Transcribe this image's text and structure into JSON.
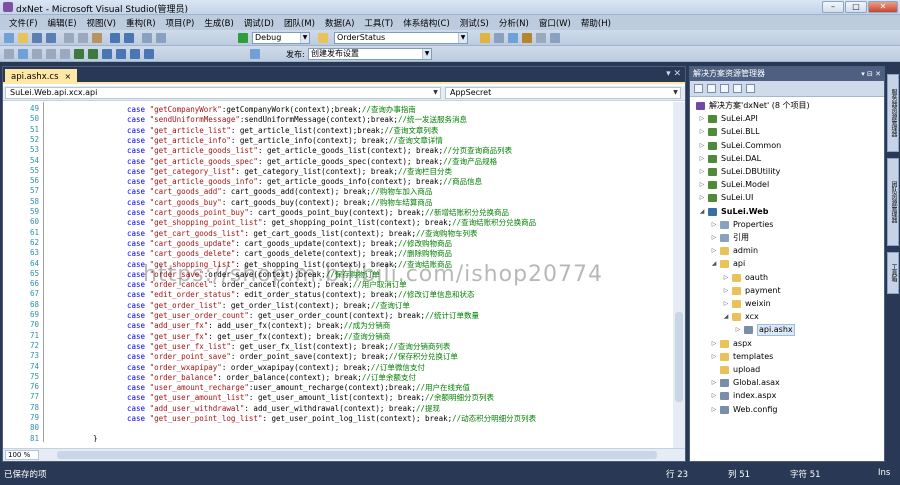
{
  "window": {
    "title": "dxNet - Microsoft Visual Studio(管理员)",
    "minimize": "–",
    "maximize": "□",
    "close": "✕"
  },
  "menu": [
    "文件(F)",
    "编辑(E)",
    "视图(V)",
    "重构(R)",
    "项目(P)",
    "生成(B)",
    "调试(D)",
    "团队(M)",
    "数据(A)",
    "工具(T)",
    "体系结构(C)",
    "测试(S)",
    "分析(N)",
    "窗口(W)",
    "帮助(H)"
  ],
  "toolbar": {
    "config": "Debug",
    "find_combo": "OrderStatus",
    "publish_label": "发布:",
    "publish_combo": "创建发布设置"
  },
  "editor": {
    "tab_label": "api.ashx.cs",
    "tab_close": "×",
    "nav_left": "SuLei.Web.api.xcx.api",
    "nav_right": "AppSecret",
    "zoom": "100 %",
    "watermark": "https://shop.m.bilibili.com/ishop20774"
  },
  "code_lines": [
    {
      "n": "49",
      "c": "case",
      "s": "\"getCompanyWork\"",
      "b": ":getCompanyWork(context);break;",
      "m": "//查询办事指南"
    },
    {
      "n": "50",
      "c": "case",
      "s": "\"sendUniformMessage\"",
      "b": ":sendUniformMessage(context);break;",
      "m": "//统一发送服务消息"
    },
    {
      "n": "51",
      "c": "case",
      "s": "\"get_article_list\"",
      "b": ": get_article_list(context);break;",
      "m": "//查询文章列表"
    },
    {
      "n": "52",
      "c": "case",
      "s": "\"get_article_info\"",
      "b": ": get_article_info(context); break;",
      "m": "//查询文章详情"
    },
    {
      "n": "53",
      "c": "case",
      "s": "\"get_article_goods_list\"",
      "b": ": get_article_goods_list(context); break;",
      "m": "//分页查询商品列表"
    },
    {
      "n": "54",
      "c": "case",
      "s": "\"get_article_goods_spec\"",
      "b": ": get_article_goods_spec(context); break;",
      "m": "//查询产品规格"
    },
    {
      "n": "55",
      "c": "case",
      "s": "\"get_category_list\"",
      "b": ": get_category_list(context); break;",
      "m": "//查询栏目分类"
    },
    {
      "n": "56",
      "c": "case",
      "s": "\"get_article_goods_info\"",
      "b": ": get_article_goods_info(context); break;",
      "m": "//商品信息"
    },
    {
      "n": "57",
      "c": "case",
      "s": "\"cart_goods_add\"",
      "b": ": cart_goods_add(context); break;",
      "m": "//购物车加入商品"
    },
    {
      "n": "58",
      "c": "case",
      "s": "\"cart_goods_buy\"",
      "b": ": cart_goods_buy(context); break;",
      "m": "//购物车结算商品"
    },
    {
      "n": "59",
      "c": "case",
      "s": "\"cart_goods_point_buy\"",
      "b": ": cart_goods_point_buy(context); break;",
      "m": "//新增结账积分兑换商品"
    },
    {
      "n": "60",
      "c": "case",
      "s": "\"get_shopping_point_list\"",
      "b": ": get_shopping_point_list(context); break;",
      "m": "//查询结账积分兑换商品"
    },
    {
      "n": "61",
      "c": "case",
      "s": "\"get_cart_goods_list\"",
      "b": ": get_cart_goods_list(context); break;",
      "m": "//查询购物车列表"
    },
    {
      "n": "62",
      "c": "case",
      "s": "\"cart_goods_update\"",
      "b": ": cart_goods_update(context); break;",
      "m": "//修改购物商品"
    },
    {
      "n": "63",
      "c": "case",
      "s": "\"cart_goods_delete\"",
      "b": ": cart_goods_delete(context); break;",
      "m": "//删除购物商品"
    },
    {
      "n": "64",
      "c": "case",
      "s": "\"get_shopping_list\"",
      "b": ": get_shopping_list(context); break;",
      "m": "//查询结账商品"
    },
    {
      "n": "65",
      "c": "case",
      "s": "\"order_save\"",
      "b": ":order_save(context);break;",
      "m": "//保存购物订单"
    },
    {
      "n": "66",
      "c": "case",
      "s": "\"order_cancel\"",
      "b": ": order_cancel(context); break;",
      "m": "//用户取消订单"
    },
    {
      "n": "67",
      "c": "case",
      "s": "\"edit_order_status\"",
      "b": ": edit_order_status(context); break;",
      "m": "//修改订单信息和状态"
    },
    {
      "n": "68",
      "c": "case",
      "s": "\"get_order_list\"",
      "b": ": get_order_list(context); break;",
      "m": "//查询订单"
    },
    {
      "n": "69",
      "c": "case",
      "s": "\"get_user_order_count\"",
      "b": ": get_user_order_count(context); break;",
      "m": "//统计订单数量"
    },
    {
      "n": "70",
      "c": "case",
      "s": "\"add_user_fx\"",
      "b": ": add_user_fx(context); break;",
      "m": "//成为分销商"
    },
    {
      "n": "71",
      "c": "case",
      "s": "\"get_user_fx\"",
      "b": ": get_user_fx(context); break;",
      "m": "//查询分销商"
    },
    {
      "n": "72",
      "c": "case",
      "s": "\"get_user_fx_list\"",
      "b": ": get_user_fx_list(context); break;",
      "m": "//查询分销商列表"
    },
    {
      "n": "73",
      "c": "case",
      "s": "\"order_point_save\"",
      "b": ": order_point_save(context); break;",
      "m": "//保存积分兑换订单"
    },
    {
      "n": "74",
      "c": "case",
      "s": "\"order_wxapipay\"",
      "b": ": order_wxapipay(context); break;",
      "m": "//订单微信支付"
    },
    {
      "n": "75",
      "c": "case",
      "s": "\"order_balance\"",
      "b": ": order_balance(context); break;",
      "m": "//订单余额支付"
    },
    {
      "n": "76",
      "c": "case",
      "s": "\"user_amount_recharge\"",
      "b": ":user_amount_recharge(context);break;",
      "m": "//用户在线充值"
    },
    {
      "n": "77",
      "c": "case",
      "s": "\"get_user_amount_list\"",
      "b": ": get_user_amount_list(context); break;",
      "m": "//余额明细分页列表"
    },
    {
      "n": "78",
      "c": "case",
      "s": "\"add_user_withdrawal\"",
      "b": ": add_user_withdrawal(context); break;",
      "m": "//提现"
    },
    {
      "n": "79",
      "c": "case",
      "s": "\"get_user_point_log_list\"",
      "b": ": get_user_point_log_list(context); break;",
      "m": "//动态积分明细分页列表"
    },
    {
      "n": "80",
      "c": "",
      "s": "",
      "b": "",
      "m": ""
    },
    {
      "n": "81",
      "c": "",
      "s": "",
      "b": "}",
      "m": ""
    }
  ],
  "solution": {
    "title": "解决方案资源管理器",
    "title_buttons": "▾ ⊟ ✕",
    "nodes": [
      {
        "label": "解决方案'dxNet' (8 个项目)",
        "depth": 0,
        "tw": "",
        "color": "#6d4aa3",
        "sel": false
      },
      {
        "label": "SuLei.API",
        "depth": 1,
        "tw": "▷",
        "color": "#4e8a3a",
        "sel": false
      },
      {
        "label": "SuLei.BLL",
        "depth": 1,
        "tw": "▷",
        "color": "#4e8a3a",
        "sel": false
      },
      {
        "label": "SuLei.Common",
        "depth": 1,
        "tw": "▷",
        "color": "#4e8a3a",
        "sel": false
      },
      {
        "label": "SuLei.DAL",
        "depth": 1,
        "tw": "▷",
        "color": "#4e8a3a",
        "sel": false
      },
      {
        "label": "SuLei.DBUtility",
        "depth": 1,
        "tw": "▷",
        "color": "#4e8a3a",
        "sel": false
      },
      {
        "label": "SuLei.Model",
        "depth": 1,
        "tw": "▷",
        "color": "#4e8a3a",
        "sel": false
      },
      {
        "label": "SuLei.UI",
        "depth": 1,
        "tw": "▷",
        "color": "#4e8a3a",
        "sel": false
      },
      {
        "label": "SuLei.Web",
        "depth": 1,
        "tw": "◢",
        "color": "#3a6ea5",
        "sel": false
      },
      {
        "label": "Properties",
        "depth": 2,
        "tw": "▷",
        "color": "#8aa0bf",
        "sel": false
      },
      {
        "label": "引用",
        "depth": 2,
        "tw": "▷",
        "color": "#8aa0bf",
        "sel": false
      },
      {
        "label": "admin",
        "depth": 2,
        "tw": "▷",
        "color": "#e8c35a",
        "sel": false
      },
      {
        "label": "api",
        "depth": 2,
        "tw": "◢",
        "color": "#e8c35a",
        "sel": false
      },
      {
        "label": "oauth",
        "depth": 3,
        "tw": "▷",
        "color": "#e8c35a",
        "sel": false
      },
      {
        "label": "payment",
        "depth": 3,
        "tw": "▷",
        "color": "#e8c35a",
        "sel": false
      },
      {
        "label": "weixin",
        "depth": 3,
        "tw": "▷",
        "color": "#e8c35a",
        "sel": false
      },
      {
        "label": "xcx",
        "depth": 3,
        "tw": "◢",
        "color": "#e8c35a",
        "sel": false
      },
      {
        "label": "api.ashx",
        "depth": 4,
        "tw": "▷",
        "color": "#7a8ea9",
        "sel": true
      },
      {
        "label": "aspx",
        "depth": 2,
        "tw": "▷",
        "color": "#e8c35a",
        "sel": false
      },
      {
        "label": "templates",
        "depth": 2,
        "tw": "▷",
        "color": "#e8c35a",
        "sel": false
      },
      {
        "label": "upload",
        "depth": 2,
        "tw": "",
        "color": "#e8c35a",
        "sel": false
      },
      {
        "label": "Global.asax",
        "depth": 2,
        "tw": "▷",
        "color": "#7a8ea9",
        "sel": false
      },
      {
        "label": "index.aspx",
        "depth": 2,
        "tw": "▷",
        "color": "#7a8ea9",
        "sel": false
      },
      {
        "label": "Web.config",
        "depth": 2,
        "tw": "▷",
        "color": "#7a8ea9",
        "sel": false
      }
    ]
  },
  "sidebar": [
    "服务器资源管理器",
    "团队资源管理器",
    "工具箱"
  ],
  "status": {
    "left": "已保存的项",
    "row": "行 23",
    "col": "列 51",
    "char": "字符 51",
    "mode": "Ins"
  },
  "colors": {
    "chrome": "#293955",
    "tab_active": "#ffe8a6",
    "keyword": "#0000ff",
    "string": "#a31515",
    "comment": "#008000",
    "line_number": "#2b91af"
  }
}
